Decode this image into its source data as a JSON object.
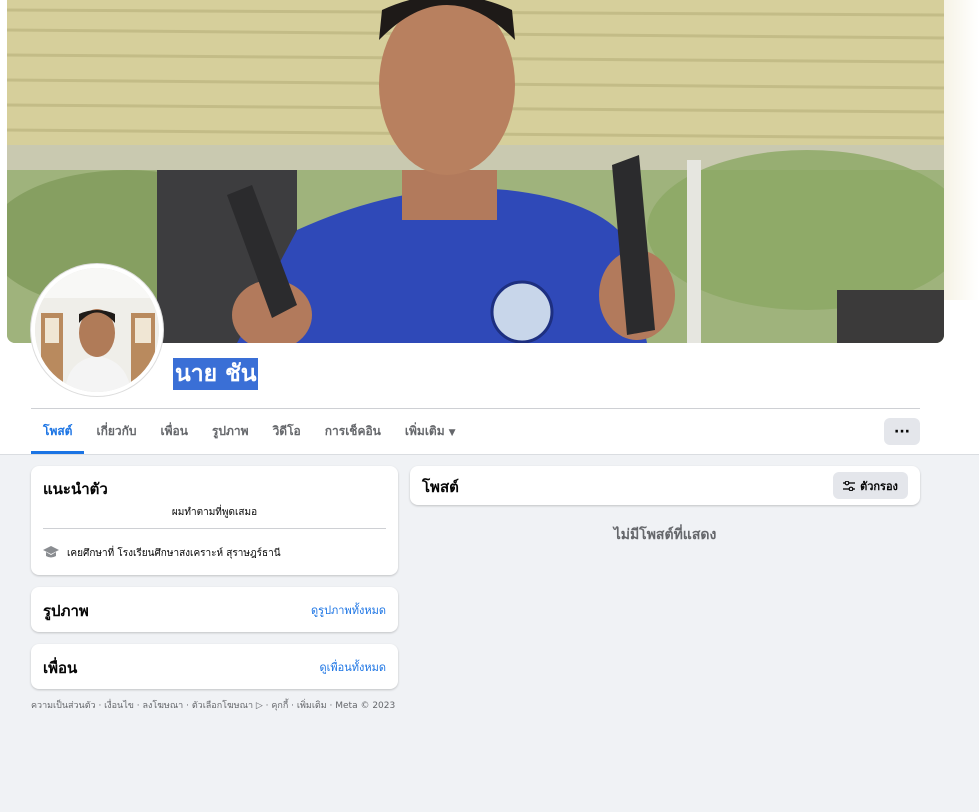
{
  "profile": {
    "name": "นาย ชัน"
  },
  "tabs": [
    {
      "label": "โพสต์",
      "active": true
    },
    {
      "label": "เกี่ยวกับ"
    },
    {
      "label": "เพื่อน"
    },
    {
      "label": "รูปภาพ"
    },
    {
      "label": "วิดีโอ"
    },
    {
      "label": "การเช็คอิน"
    },
    {
      "label": "เพิ่มเติม",
      "dropdown": true
    }
  ],
  "more_button": "···",
  "intro": {
    "title": "แนะนำตัว",
    "bio": "ผมทำตามที่พูดเสมอ",
    "education": "เคยศึกษาที่ โรงเรียนศึกษาสงเคราะห์ สุราษฎร์ธานี",
    "education_icon": "graduation-cap-icon"
  },
  "photos": {
    "title": "รูปภาพ",
    "link": "ดูรูปภาพทั้งหมด"
  },
  "friends": {
    "title": "เพื่อน",
    "link": "ดูเพื่อนทั้งหมด"
  },
  "footer": "ความเป็นส่วนตัว · เงื่อนไข · ลงโฆษณา · ตัวเลือกโฆษณา ▷ · คุกกี้ · เพิ่มเติม · Meta © 2023",
  "posts": {
    "title": "โพสต์",
    "filter_label": "ตัวกรอง",
    "empty": "ไม่มีโพสต์ที่แสดง"
  },
  "colors": {
    "accent": "#1b74e4",
    "name_highlight": "#3a6fd6",
    "background": "#f0f2f5"
  }
}
